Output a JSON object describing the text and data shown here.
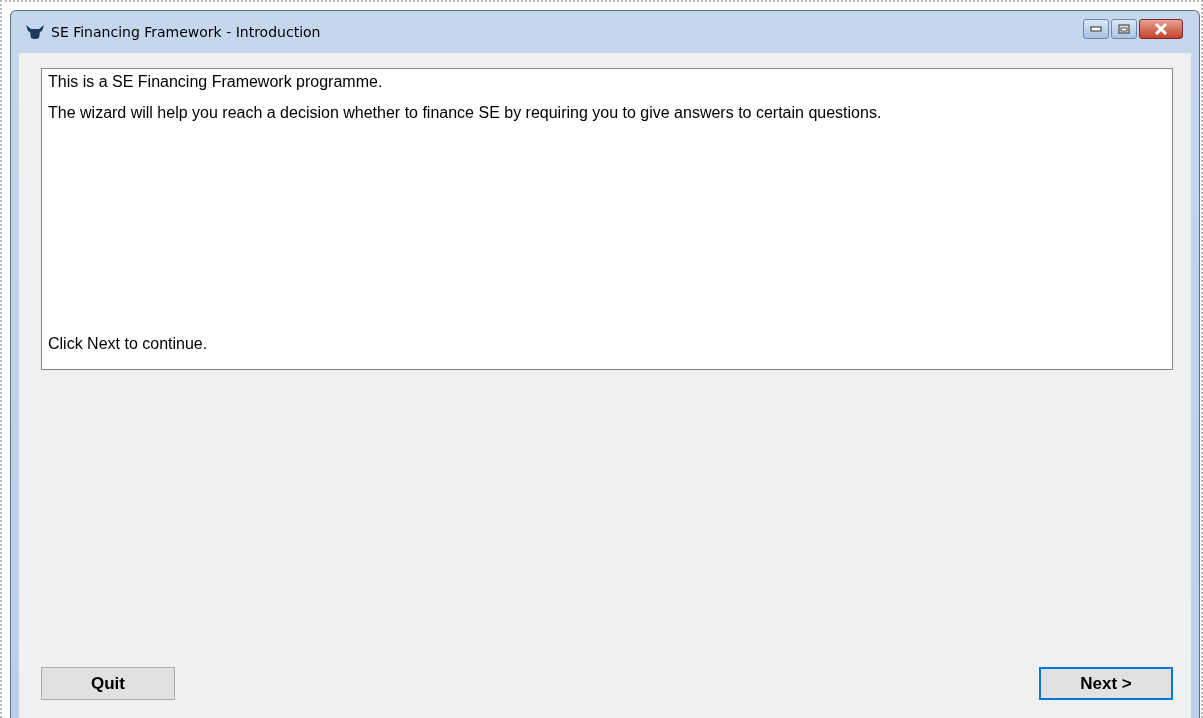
{
  "window": {
    "title": "SE Financing Framework - Introduction"
  },
  "message": {
    "lines": [
      "This is a SE Financing Framework programme.",
      "The wizard will help you reach a decision whether to finance SE by requiring you to give answers to certain questions."
    ],
    "footer": "Click Next to continue."
  },
  "buttons": [
    {
      "label": "Quit",
      "focused": false
    },
    {
      "label": "Next >",
      "focused": true
    }
  ]
}
